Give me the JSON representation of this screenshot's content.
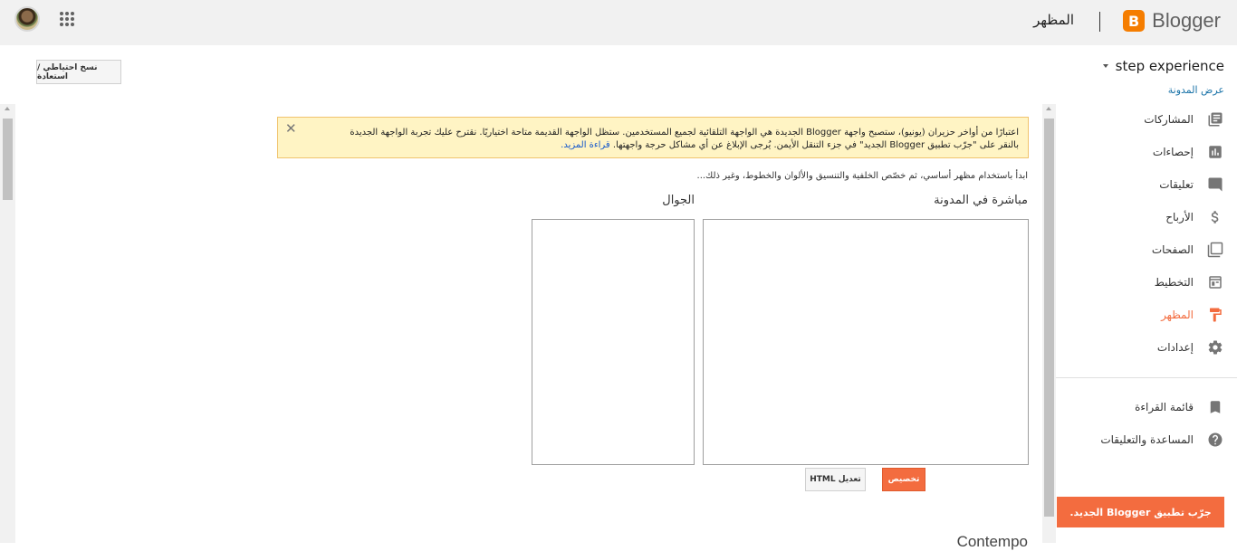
{
  "header": {
    "brand": "Blogger",
    "brand_letter": "B",
    "page_title": "المظهر",
    "avatar_icon": "avatar",
    "apps_icon": "apps-grid-icon"
  },
  "toolbar": {
    "backup_label": "نسخ احتياطي / استعادة"
  },
  "notice": {
    "text": "اعتبارًا من أواخر حزيران (يونيو)، ستصبح واجهة Blogger الجديدة هي الواجهة التلقائية لجميع المستخدمين. ستظل الواجهة القديمة متاحة اختياريًا. نقترح عليك تجربة الواجهة الجديدة بالنقر على \"جرّب تطبيق Blogger الجديد\" في جزء التنقل الأيمن. يُرجى الإبلاغ عن أي مشاكل حرجة واجهتها.",
    "link": "قراءة المزيد.",
    "close": "✕"
  },
  "main": {
    "intro": "ابدأ باستخدام مظهر أساسي، ثم خصّص الخلفية والتنسيق والألوان والخطوط، وغير ذلك...",
    "live_label": "مباشرة في المدونة",
    "mobile_label": "الجوال",
    "customize_label": "تخصيص",
    "edit_html_label": "تعديل HTML",
    "theme_name": "Contempo"
  },
  "sidebar": {
    "blog_name": "step experience",
    "view_blog": "عرض المدونة",
    "items": [
      {
        "label": "المشاركات",
        "icon": "posts-icon"
      },
      {
        "label": "إحصاءات",
        "icon": "stats-icon"
      },
      {
        "label": "تعليقات",
        "icon": "comments-icon"
      },
      {
        "label": "الأرباح",
        "icon": "earnings-icon"
      },
      {
        "label": "الصفحات",
        "icon": "pages-icon"
      },
      {
        "label": "التخطيط",
        "icon": "layout-icon"
      },
      {
        "label": "المظهر",
        "icon": "theme-icon"
      },
      {
        "label": "إعدادات",
        "icon": "settings-icon"
      }
    ],
    "secondary": [
      {
        "label": "قائمة القراءة",
        "icon": "reading-list-icon"
      },
      {
        "label": "المساعدة والتعليقات",
        "icon": "help-icon"
      }
    ],
    "try_new": "جرّب تطبيق Blogger الجديد."
  },
  "colors": {
    "accent": "#f36c3f",
    "brand": "#f57d00",
    "notice_bg": "#fff4c4"
  }
}
